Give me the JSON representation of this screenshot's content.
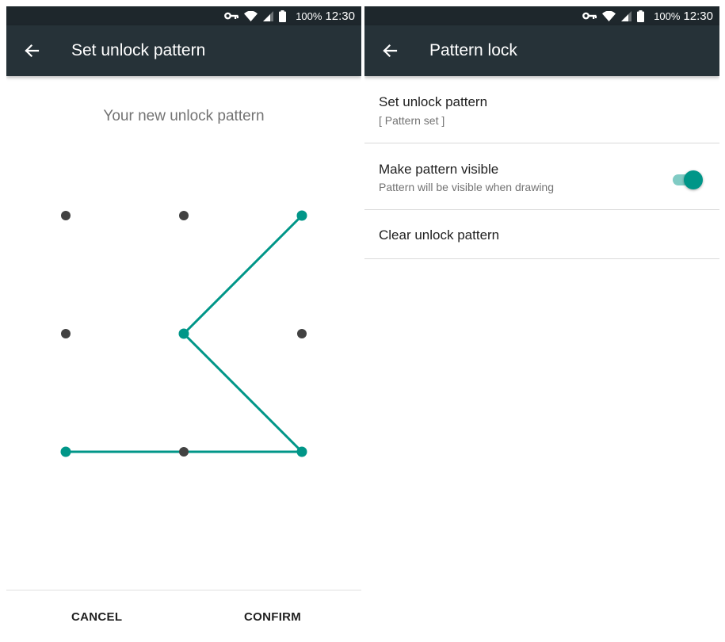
{
  "status_bar": {
    "icons": [
      "vpn-key-icon",
      "wifi-icon",
      "cell-signal-icon",
      "battery-icon"
    ],
    "battery": "100%",
    "time": "12:30"
  },
  "left_screen": {
    "title": "Set unlock pattern",
    "prompt": "Your new unlock pattern",
    "pattern": {
      "sequence": [
        2,
        4,
        8,
        6
      ],
      "line_color": "#009688",
      "active_dot_color": "#009688",
      "inactive_dot_color": "#424242"
    },
    "cancel_label": "CANCEL",
    "confirm_label": "CONFIRM"
  },
  "right_screen": {
    "title": "Pattern lock",
    "items": [
      {
        "title": "Set unlock pattern",
        "summary": "[ Pattern set ]"
      },
      {
        "title": "Make pattern visible",
        "summary": "Pattern will be visible when drawing",
        "toggle_on": true
      },
      {
        "title": "Clear unlock pattern"
      }
    ]
  },
  "colors": {
    "app_bar": "#263238",
    "status_bar": "#1e272c",
    "accent": "#009688"
  }
}
